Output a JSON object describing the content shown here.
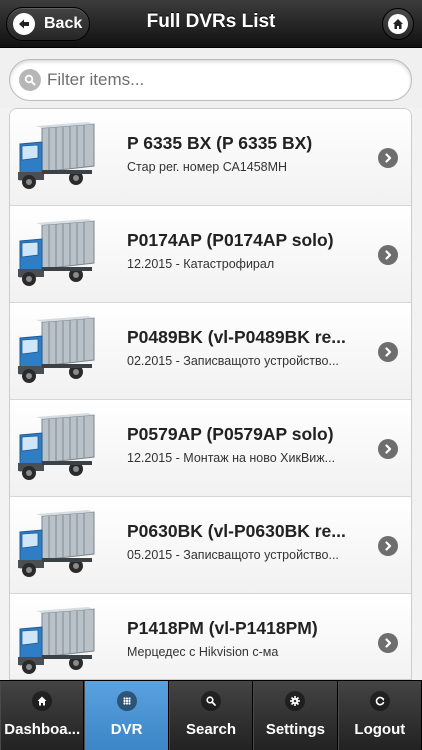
{
  "header": {
    "back_label": "Back",
    "title": "Full DVRs List"
  },
  "filter": {
    "placeholder": "Filter items..."
  },
  "items": [
    {
      "title": "P 6335 BX (P 6335 BX)",
      "subtitle": "Стар рег. номер СА1458МН"
    },
    {
      "title": "P0174AP (P0174AP solo)",
      "subtitle": "12.2015 - Катастрофирал"
    },
    {
      "title": "P0489BK (vl-P0489BK re...",
      "subtitle": "02.2015 - Записващото устройство..."
    },
    {
      "title": "P0579AP (P0579AP solo)",
      "subtitle": "12.2015 - Монтаж на ново ХикВиж..."
    },
    {
      "title": "P0630BK (vl-P0630BK re...",
      "subtitle": "05.2015 - Записващото устройство..."
    },
    {
      "title": "P1418PM (vl-P1418PM)",
      "subtitle": "Мерцедес с Hikvision с-ма"
    }
  ],
  "navbar": [
    {
      "label": "Dashboa...",
      "icon": "home-icon",
      "active": false
    },
    {
      "label": "DVR",
      "icon": "grid-icon",
      "active": true
    },
    {
      "label": "Search",
      "icon": "search-icon",
      "active": false
    },
    {
      "label": "Settings",
      "icon": "gear-icon",
      "active": false
    },
    {
      "label": "Logout",
      "icon": "refresh-icon",
      "active": false
    }
  ],
  "colors": {
    "header": "#1f1f1f",
    "active_tab": "#4a93d3",
    "list_bg": "#ffffff"
  }
}
